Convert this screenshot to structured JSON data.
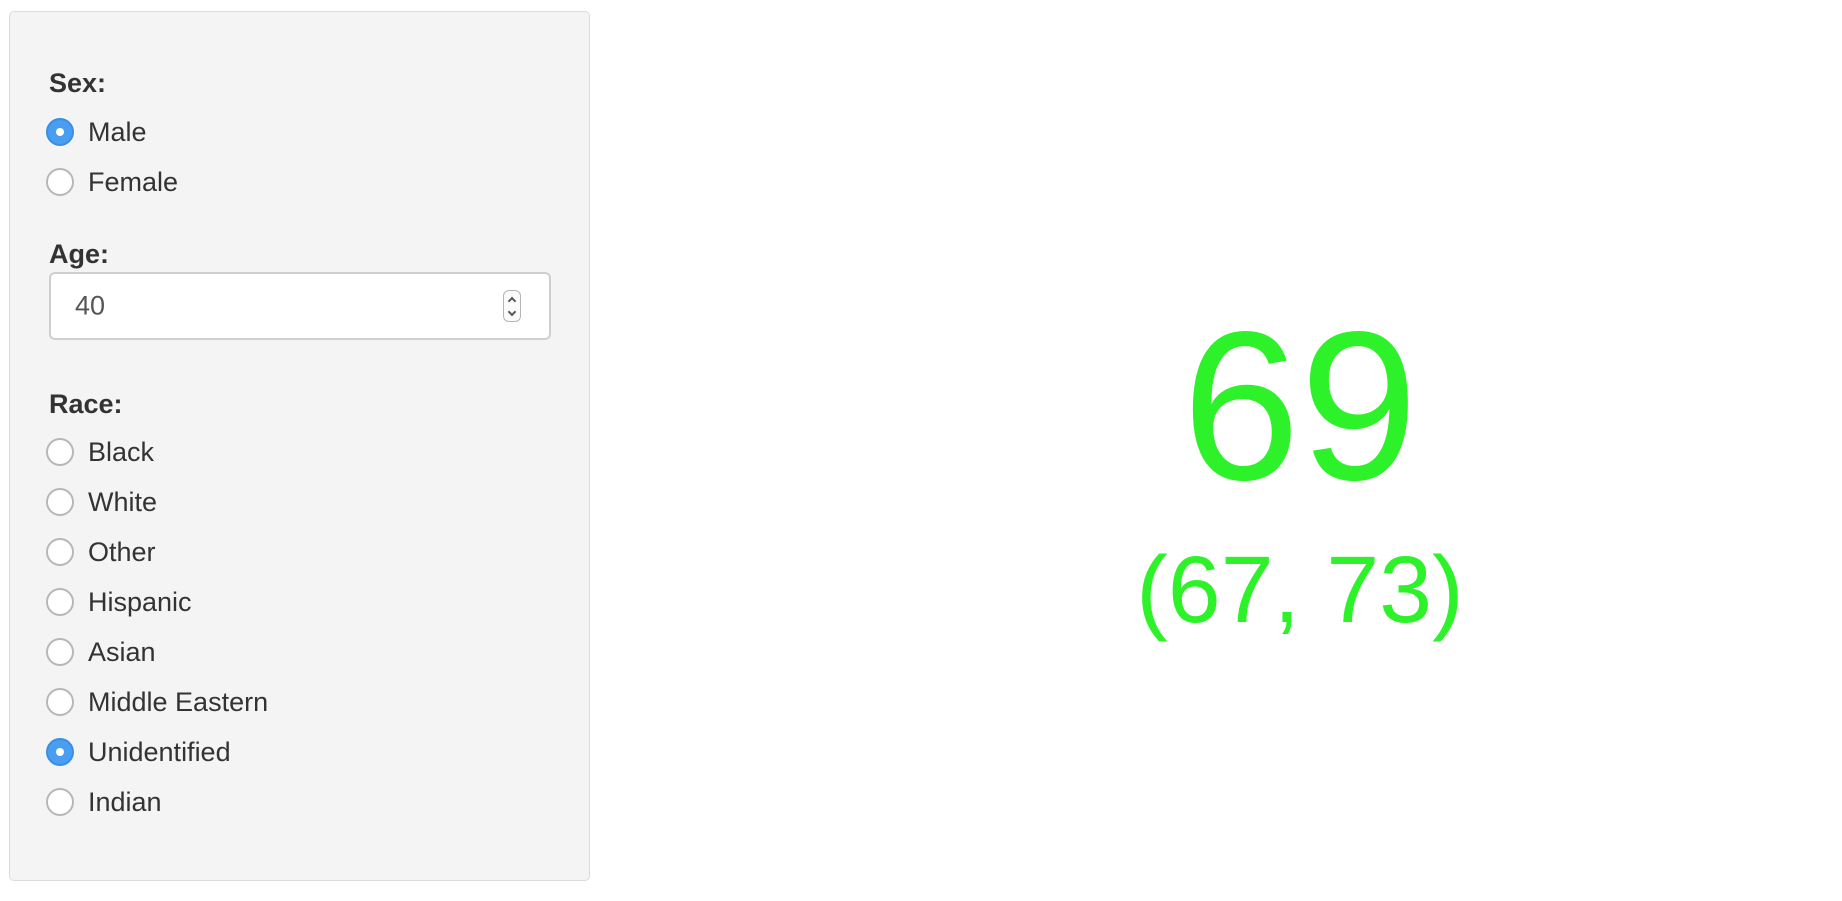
{
  "sidebar": {
    "sex": {
      "label": "Sex:",
      "options": [
        {
          "label": "Male",
          "checked": true
        },
        {
          "label": "Female",
          "checked": false
        }
      ]
    },
    "age": {
      "label": "Age:",
      "value": "40"
    },
    "race": {
      "label": "Race:",
      "options": [
        {
          "label": "Black",
          "checked": false
        },
        {
          "label": "White",
          "checked": false
        },
        {
          "label": "Other",
          "checked": false
        },
        {
          "label": "Hispanic",
          "checked": false
        },
        {
          "label": "Asian",
          "checked": false
        },
        {
          "label": "Middle Eastern",
          "checked": false
        },
        {
          "label": "Unidentified",
          "checked": true
        },
        {
          "label": "Indian",
          "checked": false
        }
      ]
    }
  },
  "result": {
    "value": "69",
    "interval": "(67, 73)",
    "color": "#2ef229"
  },
  "colors": {
    "radio_checked": "#4a9ef1",
    "panel_background": "#f4f4f4"
  }
}
